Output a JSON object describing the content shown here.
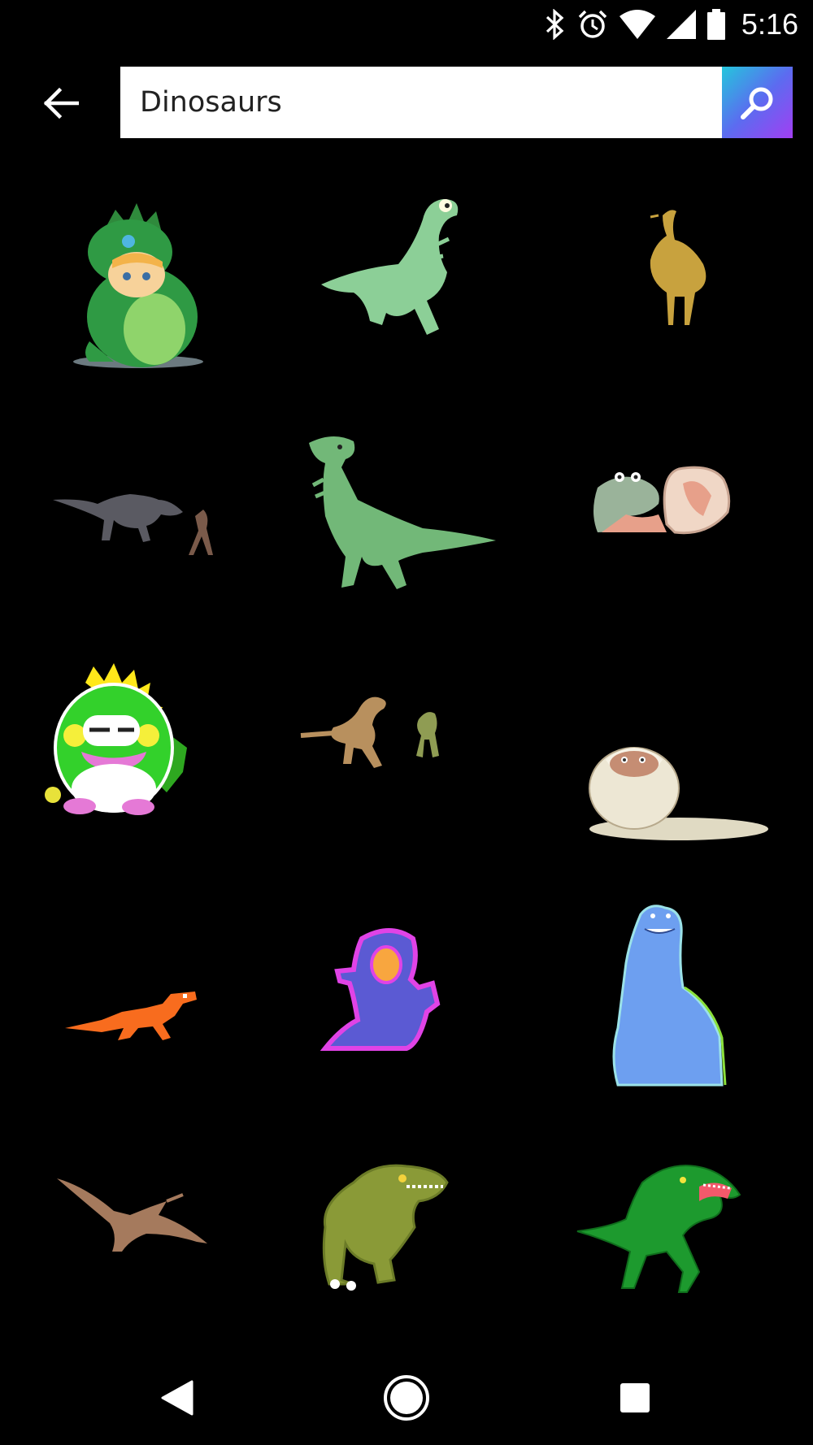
{
  "status_bar": {
    "time": "5:16",
    "icons": [
      "bluetooth-icon",
      "alarm-icon",
      "wifi-icon",
      "cell-signal-icon",
      "battery-icon"
    ]
  },
  "search": {
    "query": "Dinosaurs",
    "accent_gradient": [
      "#24c6dc",
      "#5b6cf0",
      "#a23ef2"
    ]
  },
  "results": [
    {
      "subject": "baby-in-dinosaur-costume"
    },
    {
      "subject": "running-green-dinosaur"
    },
    {
      "subject": "walking-ostrich-dinosaur"
    },
    {
      "subject": "trex-chasing-figure"
    },
    {
      "subject": "green-trex-cartoon"
    },
    {
      "subject": "crocodile-hatching-egg"
    },
    {
      "subject": "bubble-dragon"
    },
    {
      "subject": "dinosaur-and-frog-dancing"
    },
    {
      "subject": "dinosaur-hatching-egg"
    },
    {
      "subject": "orange-pixel-raptor"
    },
    {
      "subject": "neon-pixel-trex"
    },
    {
      "subject": "blue-long-neck-dinosaur"
    },
    {
      "subject": "pterodactyl-flying"
    },
    {
      "subject": "olive-cartoon-trex"
    },
    {
      "subject": "green-roaring-trex"
    }
  ],
  "nav_bar": {
    "icons": [
      "back-triangle-icon",
      "home-circle-icon",
      "recents-square-icon"
    ]
  }
}
